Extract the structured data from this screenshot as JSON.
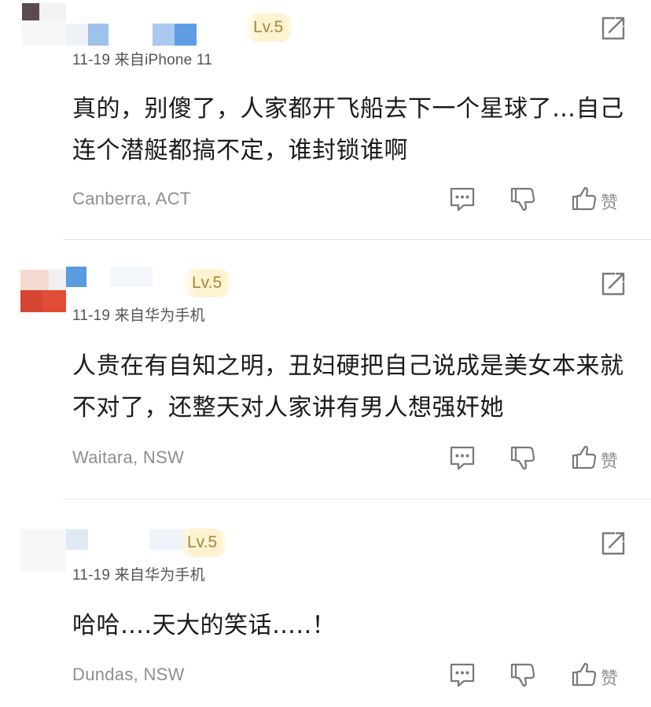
{
  "comments": [
    {
      "level": "Lv.5",
      "meta": "11-19  来自iPhone 11",
      "text": "真的，别傻了，人家都开飞船去下一个星球了…自己连个潜艇都搞不定，谁封锁谁啊",
      "location": "Canberra, ACT",
      "like_label": "赞"
    },
    {
      "level": "Lv.5",
      "meta": "11-19  来自华为手机",
      "text": "人贵在有自知之明，丑妇硬把自己说成是美女本来就不对了，还整天对人家讲有男人想强奸她",
      "location": "Waitara, NSW",
      "like_label": "赞"
    },
    {
      "level": "Lv.5",
      "meta": "11-19  来自华为手机",
      "text": "哈哈….天大的笑话…..！",
      "location": "Dundas, NSW",
      "like_label": "赞"
    }
  ],
  "icons": {
    "share": "share-icon",
    "reply": "comment-icon",
    "dislike": "thumbs-down-icon",
    "like": "thumbs-up-icon"
  },
  "colors": {
    "level_bg": "#fdf3d2",
    "level_text": "#a68a3a",
    "meta_text": "#555555",
    "secondary_text": "#8e8e8e",
    "divider": "#e6e6e6"
  }
}
